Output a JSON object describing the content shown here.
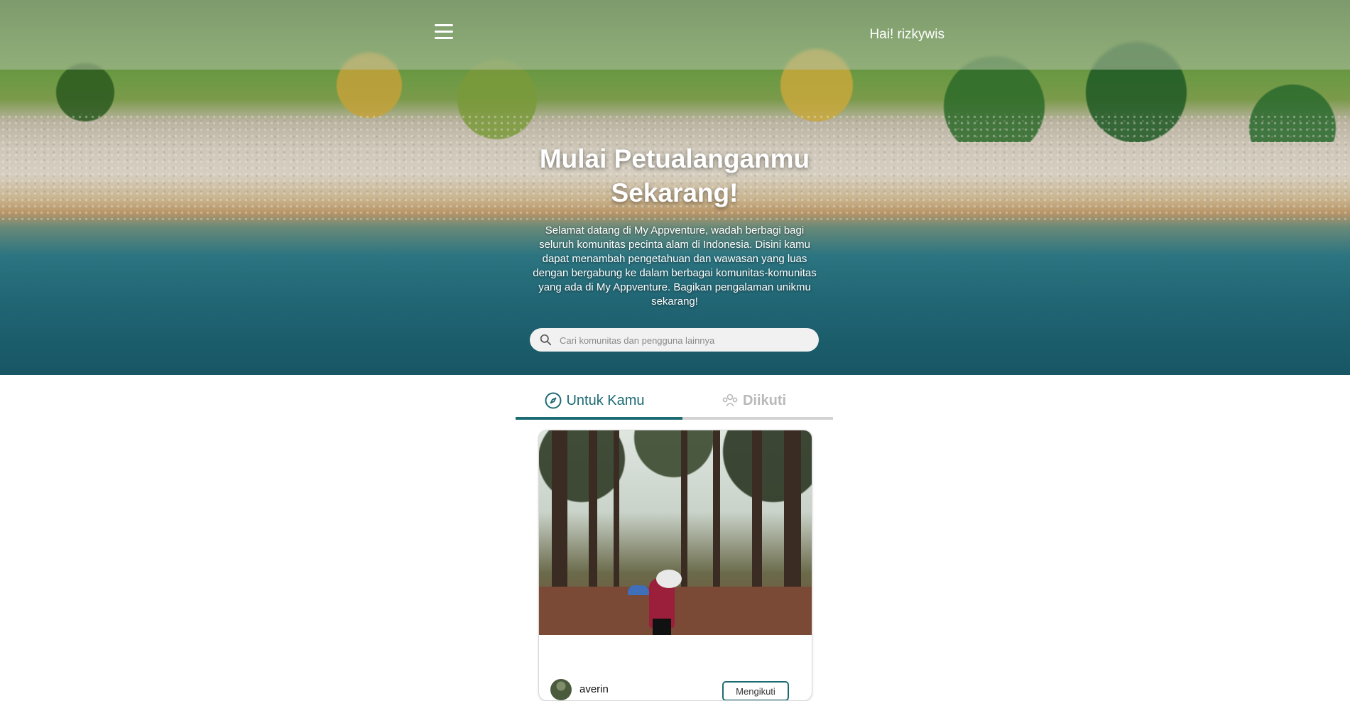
{
  "header": {
    "menu_icon": "hamburger-menu-icon",
    "greeting": "Hai! rizkywis"
  },
  "hero": {
    "title": "Mulai Petualanganmu Sekarang!",
    "description": "Selamat datang di My Appventure, wadah berbagi bagi seluruh komunitas pecinta alam di Indonesia. Disini kamu dapat menambah pengetahuan dan wawasan yang luas dengan bergabung ke dalam berbagai komunitas-komunitas yang ada di My Appventure. Bagikan pengalaman unikmu sekarang!"
  },
  "search": {
    "icon": "search-icon",
    "placeholder": "Cari komunitas dan pengguna lainnya",
    "value": ""
  },
  "tabs": [
    {
      "label": "Untuk Kamu",
      "icon": "compass-icon",
      "active": true
    },
    {
      "label": "Diikuti",
      "icon": "users-icon",
      "active": false
    }
  ],
  "feed": [
    {
      "author": "averin",
      "follow_label": "Mengikuti"
    }
  ],
  "colors": {
    "accent": "#1c6b73",
    "tab_inactive": "#b9b9b9",
    "tab_track": "#d2d2d2"
  }
}
